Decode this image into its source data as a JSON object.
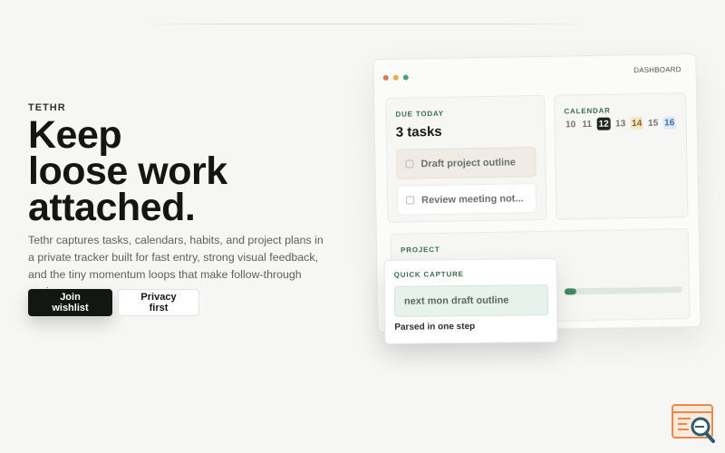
{
  "brand": "TETHR",
  "hero": {
    "headline_lines": [
      "Keep",
      "loose work",
      "attached."
    ],
    "lede": "Tethr captures tasks, calendars, habits, and project plans in a private tracker built for fast entry, strong visual feedback, and the tiny momentum loops that make follow-through easier."
  },
  "cta": {
    "primary": "Join wishlist",
    "secondary": "Privacy first"
  },
  "dashboard": {
    "title": "DASHBOARD",
    "window_dot_colors": [
      "#e2774f",
      "#e5b04a",
      "#4fa07a"
    ],
    "due": {
      "label": "DUE TODAY",
      "count": "3 tasks",
      "tasks": [
        "Draft project outline",
        "Review meeting not..."
      ]
    },
    "calendar": {
      "label": "CALENDAR",
      "days": [
        "10",
        "11",
        "12",
        "13",
        "14",
        "15",
        "16"
      ]
    },
    "project": {
      "label": "PROJECT",
      "progress": 0.1
    }
  },
  "capture": {
    "label": "QUICK CAPTURE",
    "value": "next mon draft outline",
    "note": "Parsed in one step"
  },
  "colors": {
    "accent_green": "#3a6b4f",
    "dark": "#141614",
    "background": "#f6f7f5"
  }
}
